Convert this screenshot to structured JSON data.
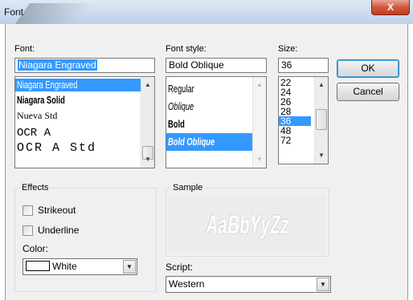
{
  "window": {
    "title": "Font",
    "close_symbol": "X"
  },
  "font": {
    "label": "Font:",
    "value": "Niagara Engraved",
    "items": [
      "Niagara Engraved",
      "Niagara Solid",
      "Nueva Std",
      "OCR A",
      "OCR A Std"
    ],
    "selected_index": 0
  },
  "style": {
    "label": "Font style:",
    "value": "Bold Oblique",
    "items": [
      "Regular",
      "Oblique",
      "Bold",
      "Bold Oblique"
    ],
    "selected_index": 3
  },
  "size": {
    "label": "Size:",
    "value": "36",
    "items": [
      "22",
      "24",
      "26",
      "28",
      "36",
      "48",
      "72"
    ],
    "selected_index": 4
  },
  "buttons": {
    "ok": "OK",
    "cancel": "Cancel"
  },
  "effects": {
    "title": "Effects",
    "strikeout_label": "Strikeout",
    "strikeout_checked": false,
    "underline_label": "Underline",
    "underline_checked": false,
    "color_label": "Color:",
    "color_value": "White",
    "color_hex": "#ffffff"
  },
  "sample": {
    "title": "Sample",
    "text": "AaBbYyZz"
  },
  "script": {
    "label": "Script:",
    "value": "Western"
  },
  "colors": {
    "selection": "#3399ff",
    "close_button": "#c8432a"
  }
}
